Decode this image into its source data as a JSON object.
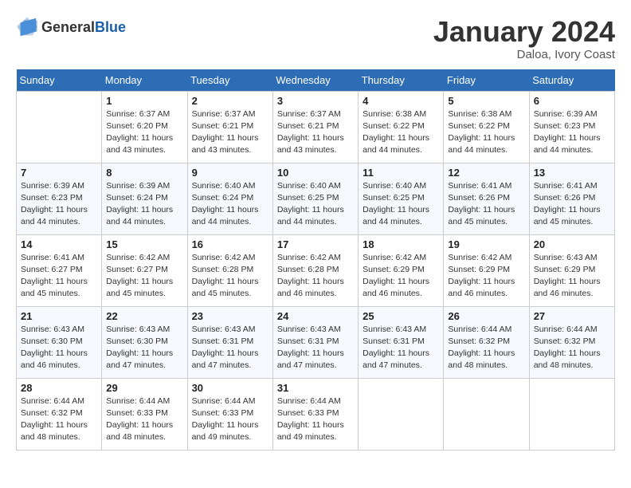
{
  "header": {
    "logo_general": "General",
    "logo_blue": "Blue",
    "month": "January 2024",
    "location": "Daloa, Ivory Coast"
  },
  "weekdays": [
    "Sunday",
    "Monday",
    "Tuesday",
    "Wednesday",
    "Thursday",
    "Friday",
    "Saturday"
  ],
  "weeks": [
    [
      {
        "day": "",
        "info": ""
      },
      {
        "day": "1",
        "info": "Sunrise: 6:37 AM\nSunset: 6:20 PM\nDaylight: 11 hours and 43 minutes."
      },
      {
        "day": "2",
        "info": "Sunrise: 6:37 AM\nSunset: 6:21 PM\nDaylight: 11 hours and 43 minutes."
      },
      {
        "day": "3",
        "info": "Sunrise: 6:37 AM\nSunset: 6:21 PM\nDaylight: 11 hours and 43 minutes."
      },
      {
        "day": "4",
        "info": "Sunrise: 6:38 AM\nSunset: 6:22 PM\nDaylight: 11 hours and 44 minutes."
      },
      {
        "day": "5",
        "info": "Sunrise: 6:38 AM\nSunset: 6:22 PM\nDaylight: 11 hours and 44 minutes."
      },
      {
        "day": "6",
        "info": "Sunrise: 6:39 AM\nSunset: 6:23 PM\nDaylight: 11 hours and 44 minutes."
      }
    ],
    [
      {
        "day": "7",
        "info": "Sunrise: 6:39 AM\nSunset: 6:23 PM\nDaylight: 11 hours and 44 minutes."
      },
      {
        "day": "8",
        "info": "Sunrise: 6:39 AM\nSunset: 6:24 PM\nDaylight: 11 hours and 44 minutes."
      },
      {
        "day": "9",
        "info": "Sunrise: 6:40 AM\nSunset: 6:24 PM\nDaylight: 11 hours and 44 minutes."
      },
      {
        "day": "10",
        "info": "Sunrise: 6:40 AM\nSunset: 6:25 PM\nDaylight: 11 hours and 44 minutes."
      },
      {
        "day": "11",
        "info": "Sunrise: 6:40 AM\nSunset: 6:25 PM\nDaylight: 11 hours and 44 minutes."
      },
      {
        "day": "12",
        "info": "Sunrise: 6:41 AM\nSunset: 6:26 PM\nDaylight: 11 hours and 45 minutes."
      },
      {
        "day": "13",
        "info": "Sunrise: 6:41 AM\nSunset: 6:26 PM\nDaylight: 11 hours and 45 minutes."
      }
    ],
    [
      {
        "day": "14",
        "info": "Sunrise: 6:41 AM\nSunset: 6:27 PM\nDaylight: 11 hours and 45 minutes."
      },
      {
        "day": "15",
        "info": "Sunrise: 6:42 AM\nSunset: 6:27 PM\nDaylight: 11 hours and 45 minutes."
      },
      {
        "day": "16",
        "info": "Sunrise: 6:42 AM\nSunset: 6:28 PM\nDaylight: 11 hours and 45 minutes."
      },
      {
        "day": "17",
        "info": "Sunrise: 6:42 AM\nSunset: 6:28 PM\nDaylight: 11 hours and 46 minutes."
      },
      {
        "day": "18",
        "info": "Sunrise: 6:42 AM\nSunset: 6:29 PM\nDaylight: 11 hours and 46 minutes."
      },
      {
        "day": "19",
        "info": "Sunrise: 6:42 AM\nSunset: 6:29 PM\nDaylight: 11 hours and 46 minutes."
      },
      {
        "day": "20",
        "info": "Sunrise: 6:43 AM\nSunset: 6:29 PM\nDaylight: 11 hours and 46 minutes."
      }
    ],
    [
      {
        "day": "21",
        "info": "Sunrise: 6:43 AM\nSunset: 6:30 PM\nDaylight: 11 hours and 46 minutes."
      },
      {
        "day": "22",
        "info": "Sunrise: 6:43 AM\nSunset: 6:30 PM\nDaylight: 11 hours and 47 minutes."
      },
      {
        "day": "23",
        "info": "Sunrise: 6:43 AM\nSunset: 6:31 PM\nDaylight: 11 hours and 47 minutes."
      },
      {
        "day": "24",
        "info": "Sunrise: 6:43 AM\nSunset: 6:31 PM\nDaylight: 11 hours and 47 minutes."
      },
      {
        "day": "25",
        "info": "Sunrise: 6:43 AM\nSunset: 6:31 PM\nDaylight: 11 hours and 47 minutes."
      },
      {
        "day": "26",
        "info": "Sunrise: 6:44 AM\nSunset: 6:32 PM\nDaylight: 11 hours and 48 minutes."
      },
      {
        "day": "27",
        "info": "Sunrise: 6:44 AM\nSunset: 6:32 PM\nDaylight: 11 hours and 48 minutes."
      }
    ],
    [
      {
        "day": "28",
        "info": "Sunrise: 6:44 AM\nSunset: 6:32 PM\nDaylight: 11 hours and 48 minutes."
      },
      {
        "day": "29",
        "info": "Sunrise: 6:44 AM\nSunset: 6:33 PM\nDaylight: 11 hours and 48 minutes."
      },
      {
        "day": "30",
        "info": "Sunrise: 6:44 AM\nSunset: 6:33 PM\nDaylight: 11 hours and 49 minutes."
      },
      {
        "day": "31",
        "info": "Sunrise: 6:44 AM\nSunset: 6:33 PM\nDaylight: 11 hours and 49 minutes."
      },
      {
        "day": "",
        "info": ""
      },
      {
        "day": "",
        "info": ""
      },
      {
        "day": "",
        "info": ""
      }
    ]
  ]
}
